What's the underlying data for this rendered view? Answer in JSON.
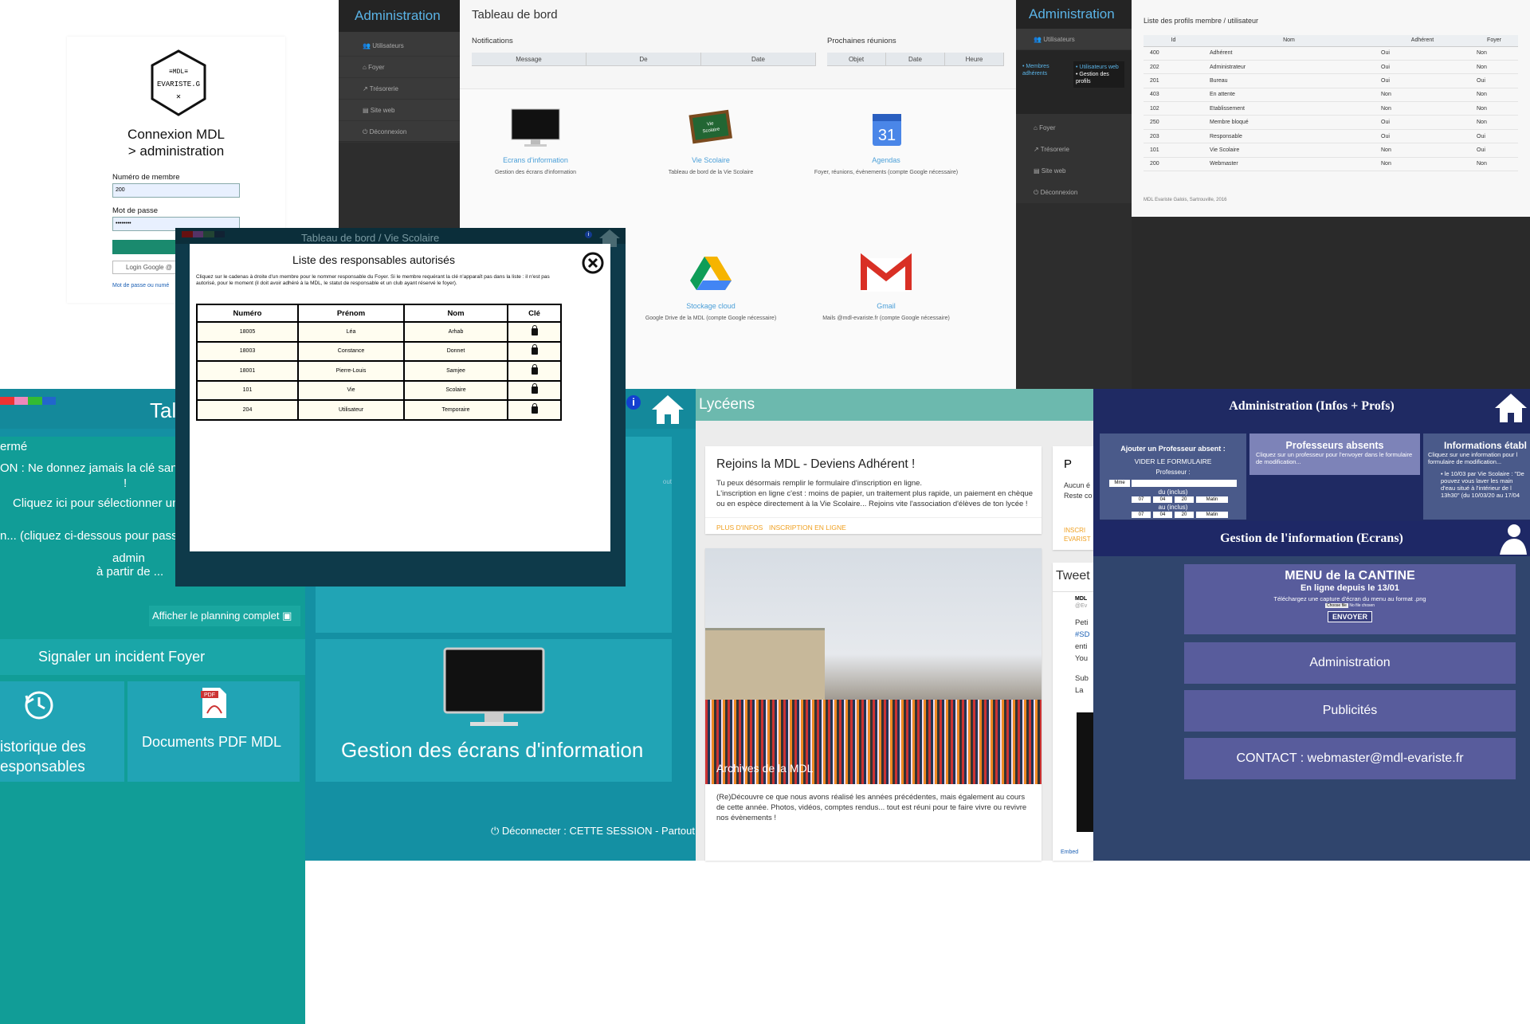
{
  "login": {
    "logo_text": "MDL EVARISTE.G",
    "title_line1": "Connexion MDL",
    "title_line2": "> administration",
    "member_label": "Numéro de membre",
    "member_value": "200",
    "password_label": "Mot de passe",
    "password_value": "••••••••",
    "connect_label": "Conn",
    "google_label": "Login Google @",
    "forgot_label": "Mot de passe ou numé"
  },
  "admin1": {
    "brand": "Administration",
    "nav": [
      "Utilisateurs",
      "Foyer",
      "Trésorerie",
      "Site web",
      "Déconnexion"
    ],
    "page_title": "Tableau de bord",
    "notifications_label": "Notifications",
    "notif_cols": [
      "Message",
      "De",
      "Date"
    ],
    "meetings_label": "Prochaines réunions",
    "meet_cols": [
      "Objet",
      "Date",
      "Heure"
    ],
    "tiles": [
      {
        "title": "Ecrans d'information",
        "desc": "Gestion des écrans d'information"
      },
      {
        "title": "Vie Scolaire",
        "desc": "Tableau de bord de la Vie Scolaire"
      },
      {
        "title": "Agendas",
        "desc": "Foyer, réunions, évènements (compte Google nécessaire)"
      },
      {
        "title": "Stockage cloud",
        "desc": "Google Drive de la MDL (compte Google nécessaire)"
      },
      {
        "title": "Gmail",
        "desc": "Mails @mdl-evariste.fr (compte Google nécessaire)"
      }
    ],
    "calendar_day": "31"
  },
  "admin2": {
    "brand": "Administration",
    "nav_users": "Utilisateurs",
    "sub_left": "• Membres adhérents",
    "sub_right1": "• Utilisateurs web",
    "sub_right2": "• Gestion des profils",
    "nav": [
      "Foyer",
      "Trésorerie",
      "Site web",
      "Déconnexion"
    ],
    "table_title": "Liste des profils membre / utilisateur",
    "cols": [
      "Id",
      "Nom",
      "Adhérent",
      "Foyer"
    ],
    "rows": [
      [
        "400",
        "Adhérent",
        "Oui",
        "Non"
      ],
      [
        "202",
        "Administrateur",
        "Oui",
        "Non"
      ],
      [
        "201",
        "Bureau",
        "Oui",
        "Oui"
      ],
      [
        "403",
        "En attente",
        "Non",
        "Non"
      ],
      [
        "102",
        "Etablissement",
        "Non",
        "Non"
      ],
      [
        "250",
        "Membre bloqué",
        "Oui",
        "Non"
      ],
      [
        "203",
        "Responsable",
        "Oui",
        "Oui"
      ],
      [
        "101",
        "Vie Scolaire",
        "Non",
        "Oui"
      ],
      [
        "200",
        "Webmaster",
        "Non",
        "Non"
      ]
    ],
    "footer": "MDL Evariste Galois, Sartrouville, 2016"
  },
  "vie": {
    "header_title": "Tal",
    "closed": "ermé",
    "warning": "ON : Ne donnez jamais la clé sans r",
    "excl": "!",
    "select": "Cliquez ici pour sélectionner un",
    "pass": "n... (cliquez ci-dessous pour passer la",
    "admin": "admin",
    "from": "à partir de ...",
    "planning": "Afficher le planning complet",
    "incident": "Signaler un incident Foyer",
    "history1": "istorique des",
    "history2": "esponsables",
    "pdf": "Documents PDF MDL",
    "screens": "Gestion des écrans d'information",
    "logout": "Déconnecter : CETTE SESSION - Partout",
    "tout": "out"
  },
  "modal": {
    "window_title": "Tableau de bord / Vie Scolaire",
    "title": "Liste des responsables autorisés",
    "intro": "Cliquez sur le cadenas à droite d'un membre pour le nommer responsable du Foyer. Si le membre requérant la clé n'apparaît pas dans la liste : il n'est pas autorisé, pour le moment (il doit avoir adhéré à la MDL, le statut de responsable et un club ayant réservé le foyer).",
    "cols": [
      "Numéro",
      "Prénom",
      "Nom",
      "Clé"
    ],
    "rows": [
      [
        "18005",
        "Léa",
        "Arhab"
      ],
      [
        "18003",
        "Constance",
        "Donnet"
      ],
      [
        "18001",
        "Pierre-Louis",
        "Samjee"
      ],
      [
        "101",
        "Vie",
        "Scolaire"
      ],
      [
        "204",
        "Utilisateur",
        "Temporaire"
      ]
    ]
  },
  "lyceens": {
    "header": "Lycéens",
    "card_title": "Rejoins la MDL - Deviens Adhérent !",
    "card_text1": "Tu peux désormais remplir le formulaire d'inscription en ligne.",
    "card_text2": "L'inscription en ligne c'est : moins de papier, un traitement plus rapide, un paiement en chèque ou en espèce directement à la Vie Scolaire... Rejoins vite l'association d'élèves de ton lycée !",
    "link1": "PLUS D'INFOS",
    "link2": "INSCRIPTION EN LIGNE",
    "photo_caption": "Archives de la MDL",
    "archive_text": "(Re)Découvre ce que nous avons réalisé les années précédentes, mais également au cours de cette année. Photos, vidéos, comptes rendus... tout est réuni pour te faire vivre ou revivre nos évènements !",
    "side_p": "P",
    "side_text1": "Aucun é",
    "side_text2": "Reste co",
    "side_links": "INSCRI EVARIST",
    "tweets": "Tweet",
    "tw_name": "MDL",
    "tw_handle": "@Ev",
    "tw_lines": [
      "Peti",
      "#SD",
      "enti",
      "You",
      "Sub",
      "La"
    ],
    "embed": "Embed"
  },
  "admin_infos": {
    "title": "Administration (Infos + Profs)",
    "absent_title": "Ajouter un Professeur absent :",
    "clear": "VIDER LE FORMULAIRE",
    "prof_label": "Professeur :",
    "prof_value": "Mme",
    "du": "du (inclus)",
    "au": "au (inclus)",
    "d1": "07",
    "d2": "04",
    "d3": "20",
    "slot": "Matin",
    "absent_box_title": "Professeurs absents",
    "absent_box_text": "Cliquez sur un professeur pour l'envoyer dans le formulaire de modification...",
    "info_title": "Informations établ",
    "info_text": "Cliquez sur une information pour l formulaire de modification...",
    "info_item": "• le 10/03 par Vie Scolaire : \"De pouvez vous laver les main d'eau situé à l'intérieur de l 13h30\" (du 10/03/20 au 17/04",
    "screens_title": "Gestion de l'information (Ecrans)",
    "menu_title": "MENU de la CANTINE",
    "menu_sub": "En ligne depuis le 13/01",
    "menu_hint": "Téléchargez une capture d'écran du menu au format .png",
    "choose": "Choose file",
    "nofile": "No file chosen",
    "send": "ENVOYER",
    "admin_btn": "Administration",
    "pubs_btn": "Publicités",
    "contact_btn": "CONTACT : webmaster@mdl-evariste.fr"
  }
}
